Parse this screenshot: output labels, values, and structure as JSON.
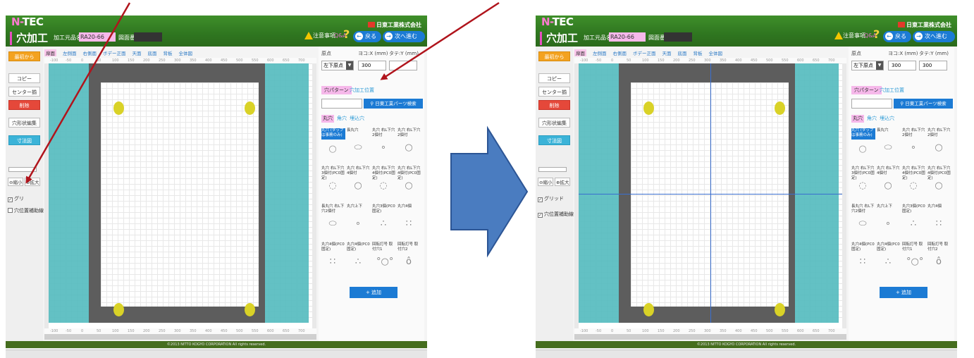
{
  "app": {
    "logo_brand": "TEC",
    "logo_brand_prefix": "N-",
    "logo_sub": "穴加工",
    "part_name_label": "加工元品名",
    "part_name_value": "RA20-66",
    "drawing_no_label": "図面番号",
    "company": "日東工業株式会社",
    "warning_label": "注意事項",
    "qa_label": "Q&A",
    "back_label": "戻る",
    "next_label": "次へ進む",
    "footer": "©2013 NITTO KOGYO CORPORATION All rights reserved."
  },
  "left_panel": {
    "start_over": "最初から",
    "copy": "コピー",
    "center_align": "センター揃",
    "delete": "削除",
    "hole_edit": "穴形状編集",
    "print_drawing": "寸法図",
    "zoom_out": "縮小",
    "zoom_in": "拡大",
    "grid_label": "グリッド",
    "grid_label_truncated": "グリ",
    "assist_line_label": "穴位置補助線"
  },
  "view_tabs": [
    "扉面",
    "左側面",
    "右側面",
    "ボデー正面",
    "天面",
    "底面",
    "背板",
    "全体図"
  ],
  "ruler": {
    "ticks": [
      "-100",
      "-50",
      "0",
      "50",
      "100",
      "150",
      "200",
      "250",
      "300",
      "350",
      "400",
      "450",
      "500",
      "550",
      "600",
      "650",
      "700"
    ]
  },
  "right_panel": {
    "origin_label": "原点",
    "x_label": "ヨコ:X (mm)",
    "y_label": "タテ:Y (mm)",
    "origin_value": "左下原点",
    "x_value": "300",
    "y_value": "300",
    "tab_pattern": "穴パターン",
    "tab_position": "穴加工位置",
    "search_button": "日東工業パーツ検索",
    "shape_tabs": [
      "丸穴",
      "角穴",
      "埋込穴"
    ],
    "shapes": [
      {
        "label": "丸穴 (タップは事務のみ)",
        "glyph": "○"
      },
      {
        "label": "長丸穴",
        "glyph": "⬭"
      },
      {
        "label": "丸穴 右L下穴2個付",
        "glyph": "∘"
      },
      {
        "label": "丸穴 右L下穴2個付",
        "glyph": "○"
      },
      {
        "label": "丸穴 右L下穴3個付(PC0固定)",
        "glyph": "◌"
      },
      {
        "label": "丸穴 右L下穴4個付",
        "glyph": "○"
      },
      {
        "label": "丸穴 右L下穴4個付(PC0固定)",
        "glyph": "◌"
      },
      {
        "label": "丸穴 右L下穴4個付(PC0固定)",
        "glyph": "○"
      },
      {
        "label": "長丸穴 右L下穴2個付",
        "glyph": "⬭"
      },
      {
        "label": "丸穴上下",
        "glyph": "∘"
      },
      {
        "label": "丸穴3個(PC0固定)",
        "glyph": "∴"
      },
      {
        "label": "丸穴4個",
        "glyph": "∷"
      },
      {
        "label": "丸穴4個(PC0固定)",
        "glyph": "∷"
      },
      {
        "label": "丸穴4個(PC0固定)",
        "glyph": "∴"
      },
      {
        "label": "回転打号 取付穴1",
        "glyph": "°○°"
      },
      {
        "label": "回転打号 取付穴2",
        "glyph": "ô"
      }
    ],
    "add_button": "追加"
  },
  "colors": {
    "header_green": "#2f7620",
    "accent_pink": "#f6b8ea",
    "button_blue": "#1c7bd4",
    "teal_fill": "#56bcbf",
    "frame_gray": "#5d5d5d",
    "hole_yellow": "#d9d227",
    "annotation_red": "#b0141c",
    "arrow_blue": "#4a7cc0"
  }
}
